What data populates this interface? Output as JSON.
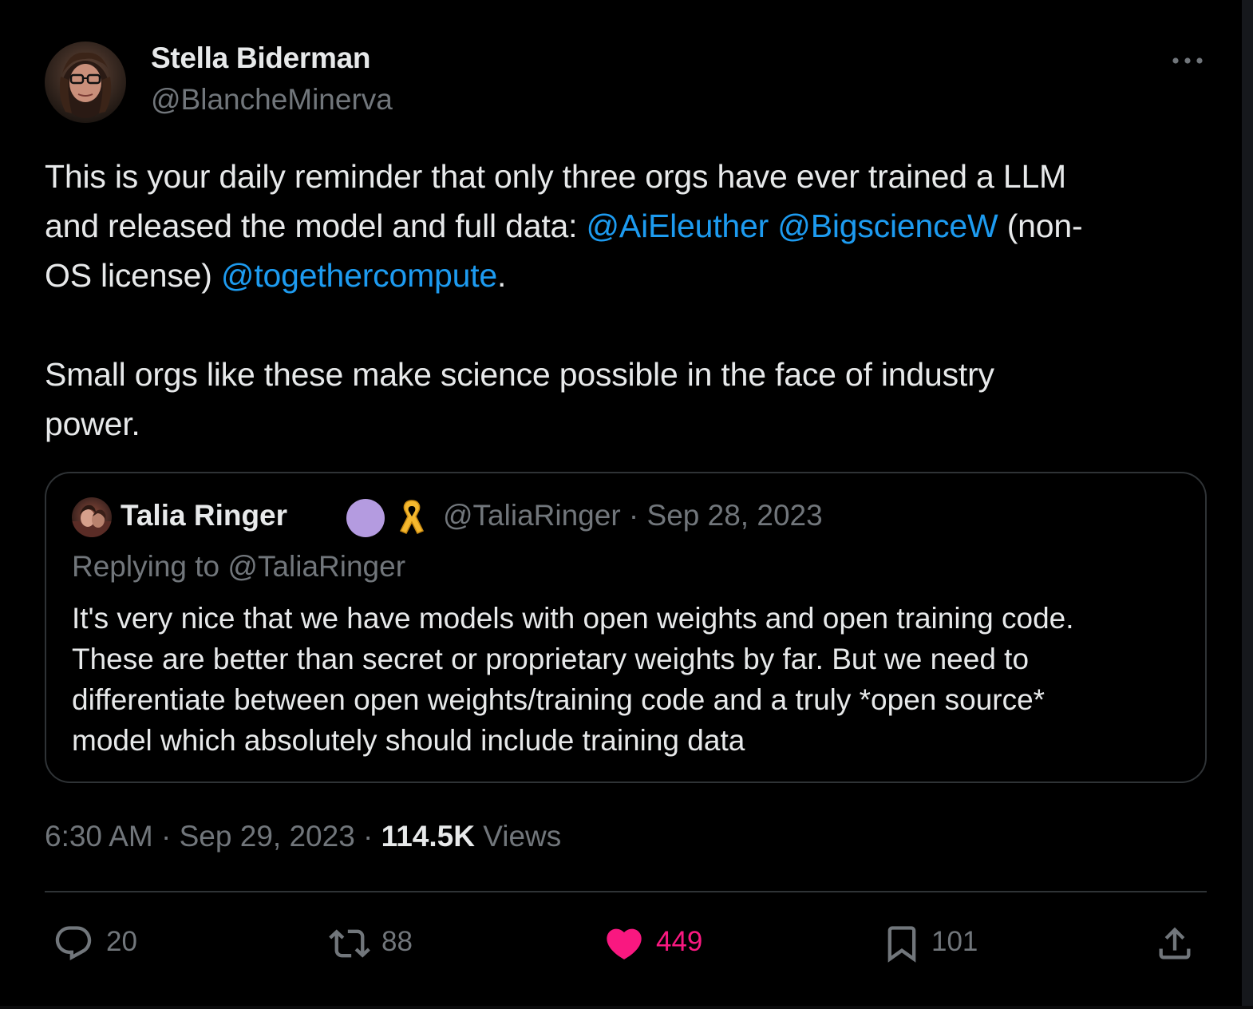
{
  "author": {
    "name": "Stella Biderman",
    "handle": "@BlancheMinerva"
  },
  "tweet": {
    "line1": "This is your daily reminder that only three orgs have ever trained a LLM",
    "line2_prefix": "and released the model and full data: ",
    "mention1": "@AiEleuther",
    "mention2": "@BigscienceW",
    "line2_suffix": " (non-",
    "line3_prefix": "OS license) ",
    "mention3": "@togethercompute",
    "line3_suffix": ".",
    "para2_line1": "Small orgs like these make science possible in the face of industry",
    "para2_line2": "power."
  },
  "quoted_tweet": {
    "name": "Talia Ringer",
    "meta": "@TaliaRinger · Sep 28, 2023",
    "replying_to": "Replying to @TaliaRinger",
    "body_lines": [
      "It's very nice that we have models with open weights and open training code.",
      "These are better than secret or proprietary weights by far. But we need to",
      "differentiate between open weights/training code and a truly *open source*",
      "model which absolutely should include training data"
    ]
  },
  "meta": {
    "time_date": "6:30 AM · Sep 29, 2023 · ",
    "views_count": "114.5K",
    "views_label": " Views"
  },
  "actions": {
    "replies": "20",
    "retweets": "88",
    "likes": "449",
    "bookmarks": "101"
  },
  "icons": {
    "more": "more-horizontal-icon",
    "reply": "reply-icon",
    "retweet": "retweet-icon",
    "like": "heart-filled-icon",
    "bookmark": "bookmark-icon",
    "share": "share-icon",
    "verified_badge": "purple-circle-badge",
    "ribbon": "yellow-ribbon-icon"
  },
  "colors": {
    "background": "#000000",
    "text": "#e7e9ea",
    "muted": "#71767b",
    "link": "#1d9bf0",
    "like": "#f91880",
    "border": "#2f3336",
    "badge": "#b49be0",
    "ribbon": "#f5b82e"
  }
}
